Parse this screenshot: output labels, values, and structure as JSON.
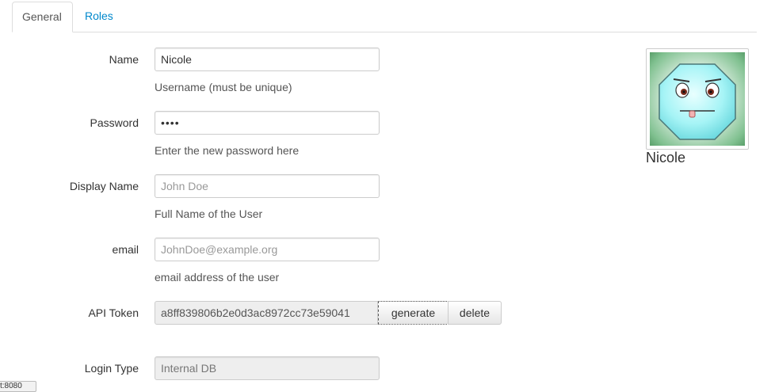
{
  "tabs": [
    {
      "label": "General",
      "active": true
    },
    {
      "label": "Roles",
      "active": false
    }
  ],
  "form": {
    "name": {
      "label": "Name",
      "value": "Nicole",
      "help": "Username (must be unique)"
    },
    "password": {
      "label": "Password",
      "value": "••••",
      "help": "Enter the new password here"
    },
    "display_name": {
      "label": "Display Name",
      "placeholder": "John Doe",
      "value": "",
      "help": "Full Name of the User"
    },
    "email": {
      "label": "email",
      "placeholder": "JohnDoe@example.org",
      "value": "",
      "help": "email address of the user"
    },
    "api_token": {
      "label": "API Token",
      "value": "a8ff839806b2e0d3ac8972cc73e59041",
      "generate_label": "generate",
      "delete_label": "delete"
    },
    "login_type": {
      "label": "Login Type",
      "value": "Internal DB"
    }
  },
  "avatar": {
    "name": "Nicole",
    "icon": "octagon-face-avatar"
  },
  "status_tip": {
    "text": "t:8080"
  },
  "colors": {
    "link": "#0088cc",
    "border": "#cccccc",
    "readonly_bg": "#eeeeee"
  }
}
